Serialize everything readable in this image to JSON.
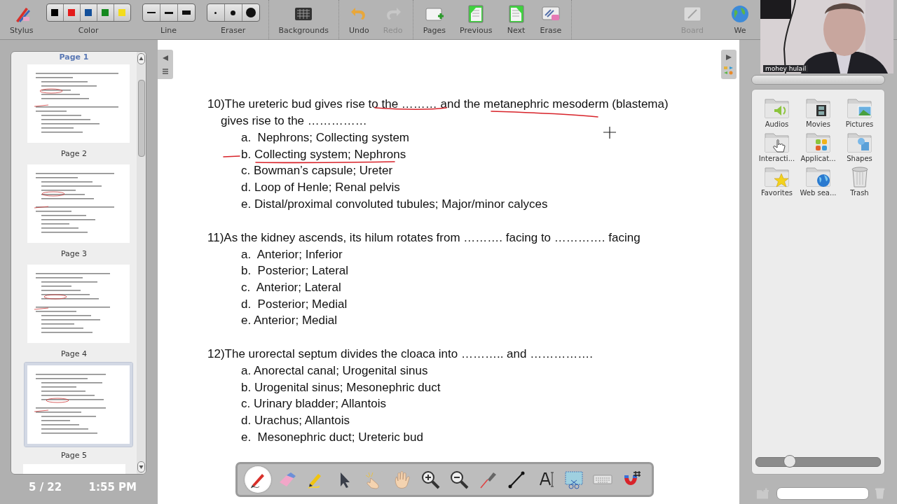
{
  "toolbar": {
    "left": [
      {
        "kind": "tool",
        "label": "Stylus",
        "disabled": false
      },
      {
        "kind": "swatches",
        "label": "Color",
        "swatches": [
          {
            "color": "#000000"
          },
          {
            "color": "#e31b1b"
          },
          {
            "color": "#14509a"
          },
          {
            "color": "#15891f"
          },
          {
            "color": "#f3dc1c"
          }
        ]
      },
      {
        "kind": "widths",
        "label": "Line"
      },
      {
        "kind": "dots",
        "label": "Eraser"
      },
      {
        "kind": "tool",
        "label": "Backgrounds",
        "disabled": false
      },
      {
        "kind": "tool",
        "label": "Undo",
        "disabled": false
      },
      {
        "kind": "tool",
        "label": "Redo",
        "disabled": true
      },
      {
        "kind": "tool",
        "label": "Pages",
        "disabled": false
      },
      {
        "kind": "tool",
        "label": "Previous",
        "disabled": false
      },
      {
        "kind": "tool",
        "label": "Next",
        "disabled": false
      },
      {
        "kind": "tool",
        "label": "Erase",
        "disabled": false
      }
    ],
    "right": [
      {
        "kind": "tool",
        "label": "Board",
        "disabled": true
      },
      {
        "kind": "tool",
        "label": "We",
        "disabled": false
      }
    ]
  },
  "video": {
    "participant": "mohey hulail"
  },
  "pages_panel": {
    "heading": "Page 1",
    "thumbnails": [
      {
        "caption": "Page 2",
        "selected": false
      },
      {
        "caption": "Page 3",
        "selected": false
      },
      {
        "caption": "Page 4",
        "selected": false
      },
      {
        "caption": "Page 5",
        "selected": true
      }
    ],
    "page_counter": "5 / 22",
    "clock": "1:55 PM"
  },
  "document": {
    "questions": [
      {
        "text": "10)The ureteric bud gives rise to the ……… and the metanephric mesoderm (blastema) gives rise to the ……………",
        "options": [
          "a.  Nephrons; Collecting system",
          "b. Collecting system; Nephrons",
          "c. Bowman’s capsule; Ureter",
          "d. Loop of Henle; Renal pelvis",
          "e. Distal/proximal convoluted tubules; Major/minor calyces"
        ]
      },
      {
        "text": "11)As the kidney ascends, its hilum rotates from ………. facing to …………. facing",
        "options": [
          "a.  Anterior; Inferior",
          "b.  Posterior; Lateral",
          "c.  Anterior; Lateral",
          "d.  Posterior; Medial",
          "e. Anterior; Medial"
        ]
      },
      {
        "text": "12)The urorectal septum divides the cloaca into ……….. and …………….",
        "options": [
          "a. Anorectal canal; Urogenital sinus",
          "b. Urogenital sinus; Mesonephric duct",
          "c. Urinary bladder; Allantois",
          "d. Urachus; Allantois",
          "e.  Mesonephric duct; Ureteric bud"
        ]
      }
    ]
  },
  "tools": [
    {
      "selected": true
    },
    {
      "selected": false
    },
    {
      "selected": false
    },
    {
      "selected": false
    },
    {
      "selected": false
    },
    {
      "selected": false
    },
    {
      "selected": false
    },
    {
      "selected": false
    },
    {
      "selected": false
    },
    {
      "selected": false
    },
    {
      "selected": false
    },
    {
      "selected": false
    },
    {
      "selected": false
    },
    {
      "selected": false
    }
  ],
  "gallery": {
    "folders": [
      {
        "label": "Audios"
      },
      {
        "label": "Movies"
      },
      {
        "label": "Pictures"
      },
      {
        "label": "Interacti..."
      },
      {
        "label": "Applicat..."
      },
      {
        "label": "Shapes"
      },
      {
        "label": "Favorites"
      },
      {
        "label": "Web sea..."
      },
      {
        "label": "Trash"
      }
    ],
    "zoom": {
      "level": 0.27
    }
  }
}
